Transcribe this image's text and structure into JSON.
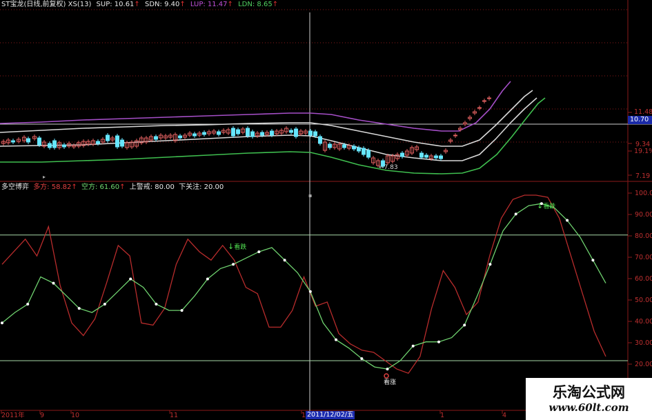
{
  "colors": {
    "background": "#000000",
    "grid": "#8b1a1a",
    "candle_up": "#e06060",
    "candle_down": "#66e6ff",
    "band_sup": "#a54fc8",
    "band_mid": "#d8d8d8",
    "band_sdn": "#3fbf4f",
    "line_duofang": "#b82c2c",
    "line_kongfang": "#6fd26f",
    "level_lines": "#a8d8a8"
  },
  "top_panel": {
    "header": {
      "name": "ST宝龙(日线,前复权)",
      "indicator": "XS(13)",
      "sup": "SUP: 10.61",
      "sdn": "SDN: 9.40",
      "lup": "LUP: 11.47",
      "ldn": "LDN: 8.65"
    },
    "y_labels": [
      "11.48",
      "9.34",
      "19.1%",
      "7.19"
    ],
    "current_price": "10.70",
    "low_marker": "7.83"
  },
  "bottom_panel": {
    "header": {
      "name": "多空博弈",
      "duofang": "多方: 58.82",
      "kongfang": "空方: 61.60",
      "shangjingjie": "上警戒: 80.00",
      "xiaguanzhu": "下关注: 20.00"
    },
    "y_labels": [
      "100.0",
      "90.00",
      "80.00",
      "70.00",
      "60.00",
      "50.00",
      "40.00",
      "30.00",
      "20.00"
    ],
    "signals": [
      "看跌",
      "看涨",
      "看跌"
    ]
  },
  "x_axis": {
    "labels": [
      "2011年",
      "9",
      "10",
      "11",
      "1",
      "1",
      "4"
    ],
    "cursor_date": "2011/12/02/五"
  },
  "chart_data": [
    {
      "type": "line",
      "title": "ST宝龙(日线,前复权) XS(13)",
      "series": [
        {
          "name": "SUP",
          "values": []
        },
        {
          "name": "SDN",
          "values": []
        },
        {
          "name": "LUP",
          "values": []
        },
        {
          "name": "LDN",
          "values": []
        }
      ],
      "ylim": [
        7.19,
        11.48
      ],
      "grid": true
    },
    {
      "type": "line",
      "title": "多空博弈",
      "ylim": [
        20,
        100
      ],
      "reference_lines": [
        80,
        20
      ],
      "series": [
        {
          "name": "多方",
          "values": [
            66,
            72,
            78,
            70,
            84,
            56,
            38,
            32,
            40,
            57,
            75,
            70,
            38,
            37,
            45,
            66,
            78,
            72,
            68,
            75,
            68,
            55,
            52,
            36,
            36,
            44,
            60,
            46,
            48,
            33,
            28,
            25,
            24,
            20,
            16,
            14,
            22,
            45,
            63,
            55,
            42,
            48,
            70,
            88,
            97,
            99,
            99,
            98,
            88,
            70,
            52,
            34,
            22
          ]
        },
        {
          "name": "空方",
          "values": [
            38,
            43,
            47,
            60,
            57,
            51,
            45,
            43,
            47,
            53,
            59,
            55,
            47,
            44,
            44,
            51,
            59,
            64,
            66,
            69,
            72,
            74,
            68,
            62,
            53,
            38,
            30,
            26,
            21,
            17,
            16,
            20,
            27,
            29,
            29,
            31,
            37,
            51,
            66,
            82,
            90,
            94,
            95,
            93,
            87,
            79,
            68,
            57
          ]
        }
      ]
    }
  ]
}
